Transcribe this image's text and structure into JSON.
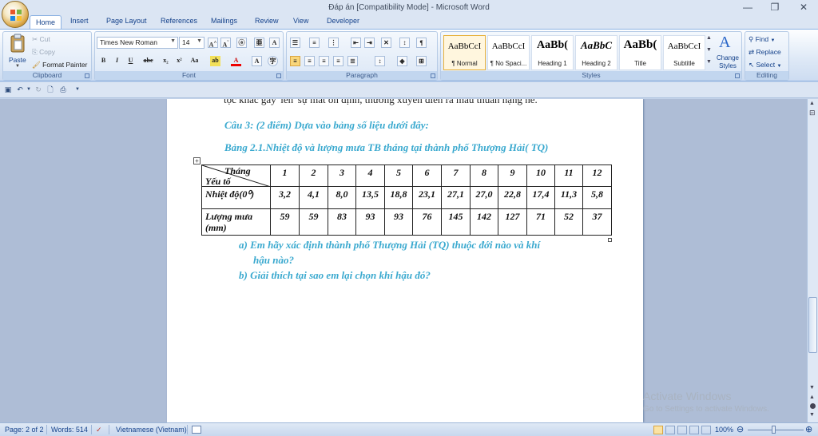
{
  "window": {
    "title": "Đáp án [Compatibility Mode] - Microsoft Word",
    "minimize": "—",
    "restore": "❐",
    "close": "✕"
  },
  "tabs": [
    "Home",
    "Insert",
    "Page Layout",
    "References",
    "Mailings",
    "Review",
    "View",
    "Developer"
  ],
  "ribbon": {
    "clipboard": {
      "label": "Clipboard",
      "paste": "Paste",
      "cut": "Cut",
      "copy": "Copy",
      "format_painter": "Format Painter"
    },
    "font": {
      "label": "Font",
      "font_name": "Times New Roman",
      "font_size": "14"
    },
    "paragraph": {
      "label": "Paragraph"
    },
    "styles": {
      "label": "Styles",
      "items": [
        {
          "sample": "AaBbCcI",
          "name": "¶ Normal"
        },
        {
          "sample": "AaBbCcI",
          "name": "¶ No Spaci..."
        },
        {
          "sample": "AaBb(",
          "name": "Heading 1"
        },
        {
          "sample": "AaBbC",
          "name": "Heading 2"
        },
        {
          "sample": "AaBb(",
          "name": "Title"
        },
        {
          "sample": "AaBbCcI",
          "name": "Subtitle"
        }
      ],
      "change_styles": "Change Styles"
    },
    "editing": {
      "label": "Editing",
      "find": "Find",
      "replace": "Replace",
      "select": "Select"
    }
  },
  "document": {
    "cut_line": "tộc khác gây 'lên' sự mất ổn định, thường xuyên diễn ra mâu thuẫn nặng nề.",
    "question": "Câu 3: (2 điểm) Dựa vào bảng số liệu dưới đây:",
    "table_caption": "Bảng 2.1.Nhiệt độ và lượng mưa TB tháng tại thành phố Thượng Hải( TQ)",
    "table": {
      "corner_top": "Tháng",
      "corner_bottom": "Yếu tố",
      "months": [
        "1",
        "2",
        "3",
        "4",
        "5",
        "6",
        "7",
        "8",
        "9",
        "10",
        "11",
        "12"
      ],
      "rows": [
        {
          "label": "Nhiệt độ(0⁰)",
          "values": [
            "3,2",
            "4,1",
            "8,0",
            "13,5",
            "18,8",
            "23,1",
            "27,1",
            "27,0",
            "22,8",
            "17,4",
            "11,3",
            "5,8"
          ]
        },
        {
          "label": "Lượng mưa (mm)",
          "values": [
            "59",
            "59",
            "83",
            "93",
            "93",
            "76",
            "145",
            "142",
            "127",
            "71",
            "52",
            "37"
          ]
        }
      ]
    },
    "item_a_1": "a)  Em hãy xác định thành phố Thượng Hải (TQ) thuộc đới nào và khí",
    "item_a_2": "hậu nào?",
    "item_b": "b)  Giải thích tại sao em lại chọn khí hậu đó?"
  },
  "status": {
    "page": "Page: 2 of 2",
    "words": "Words: 514",
    "language": "Vietnamese (Vietnam)",
    "zoom": "100%"
  },
  "watermark": {
    "title": "Activate Windows",
    "subtitle": "Go to Settings to activate Windows."
  }
}
